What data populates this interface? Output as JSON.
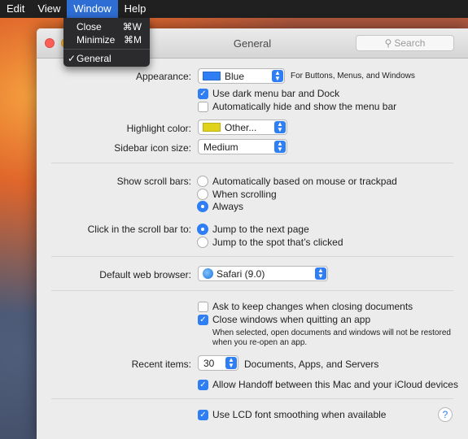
{
  "menubar": {
    "items": [
      "Edit",
      "View",
      "Window",
      "Help"
    ],
    "active": "Window"
  },
  "window_menu": {
    "items": [
      {
        "label": "Close",
        "shortcut": "⌘W"
      },
      {
        "label": "Minimize",
        "shortcut": "⌘M"
      }
    ],
    "checked_item": {
      "check": "✓",
      "label": "General"
    }
  },
  "window": {
    "title": "General",
    "search_placeholder": "Search",
    "search_icon": "magnifier-icon"
  },
  "appearance": {
    "label": "Appearance:",
    "value": "Blue",
    "swatch_color": "#2f7ef3",
    "note": "For Buttons, Menus, and Windows",
    "dark_menu": {
      "label": "Use dark menu bar and Dock",
      "checked": true
    },
    "autohide_menu": {
      "label": "Automatically hide and show the menu bar",
      "checked": false
    }
  },
  "highlight": {
    "label": "Highlight color:",
    "value": "Other...",
    "swatch_color": "#e0d21a"
  },
  "sidebar_icon": {
    "label": "Sidebar icon size:",
    "value": "Medium"
  },
  "scroll_bars": {
    "label": "Show scroll bars:",
    "options": [
      "Automatically based on mouse or trackpad",
      "When scrolling",
      "Always"
    ],
    "selected": "Always"
  },
  "click_scroll": {
    "label": "Click in the scroll bar to:",
    "options": [
      "Jump to the next page",
      "Jump to the spot that’s clicked"
    ],
    "selected": "Jump to the next page"
  },
  "browser": {
    "label": "Default web browser:",
    "value": "Safari (9.0)"
  },
  "documents": {
    "ask_keep": {
      "label": "Ask to keep changes when closing documents",
      "checked": false
    },
    "close_windows": {
      "label": "Close windows when quitting an app",
      "checked": true
    },
    "note_line1": "When selected, open documents and windows will not be restored",
    "note_line2": "when you re-open an app."
  },
  "recent": {
    "label": "Recent items:",
    "value": "30",
    "suffix": "Documents, Apps, and Servers"
  },
  "handoff": {
    "label": "Allow Handoff between this Mac and your iCloud devices",
    "checked": true
  },
  "lcd": {
    "label": "Use LCD font smoothing when available",
    "checked": true
  },
  "help_label": "?",
  "accent_color": "#2f7ef3"
}
